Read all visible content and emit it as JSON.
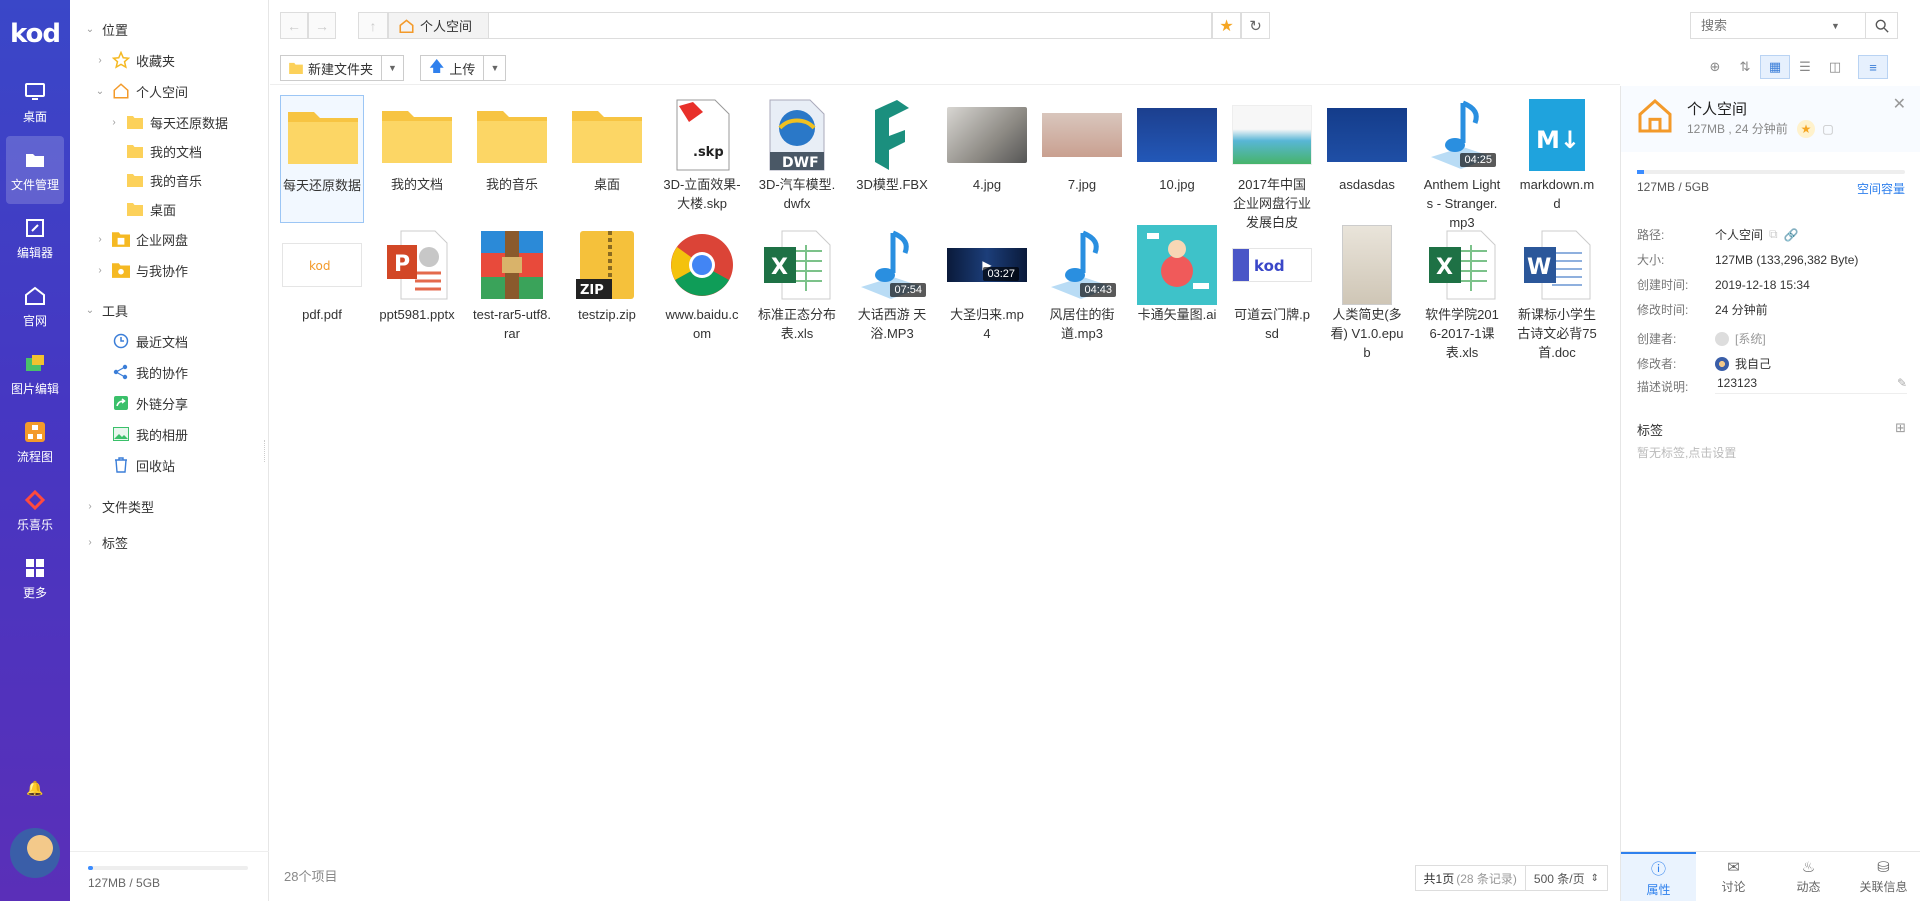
{
  "app": {
    "logo": "kod",
    "nav": [
      {
        "label": "桌面",
        "icon": "desktop-icon"
      },
      {
        "label": "文件管理",
        "icon": "folder-icon"
      },
      {
        "label": "编辑器",
        "icon": "editor-icon"
      },
      {
        "label": "官网",
        "icon": "home-icon"
      },
      {
        "label": "图片编辑",
        "icon": "image-edit-icon"
      },
      {
        "label": "流程图",
        "icon": "flowchart-icon"
      },
      {
        "label": "乐喜乐",
        "icon": "music-icon"
      },
      {
        "label": "更多",
        "icon": "grid-icon"
      }
    ]
  },
  "tree": {
    "location_title": "位置",
    "favorites": "收藏夹",
    "personal": "个人空间",
    "children": [
      "每天还原数据",
      "我的文档",
      "我的音乐",
      "桌面"
    ],
    "enterprise": "企业网盘",
    "collab": "与我协作",
    "tools_title": "工具",
    "tools": [
      "最近文档",
      "我的协作",
      "外链分享",
      "我的相册",
      "回收站"
    ],
    "file_types": "文件类型",
    "tags": "标签",
    "quota": "127MB / 5GB"
  },
  "topbar": {
    "path": "个人空间",
    "search_placeholder": "搜索"
  },
  "toolbar": {
    "new_folder": "新建文件夹",
    "upload": "上传"
  },
  "files_row1": [
    {
      "name": "每天还原数据",
      "kind": "folder",
      "selected": true
    },
    {
      "name": "我的文档",
      "kind": "folder"
    },
    {
      "name": "我的音乐",
      "kind": "folder"
    },
    {
      "name": "桌面",
      "kind": "folder"
    },
    {
      "name": "3D-立面效果-大楼.skp",
      "kind": "skp",
      "tag": ".skp"
    },
    {
      "name": "3D-汽车模型.dwfx",
      "kind": "dwf",
      "tag": "DWF"
    },
    {
      "name": "3D模型.FBX",
      "kind": "fbx"
    },
    {
      "name": "4.jpg",
      "kind": "photo-cat"
    },
    {
      "name": "7.jpg",
      "kind": "photo-sand"
    },
    {
      "name": "10.jpg",
      "kind": "photo-blue"
    },
    {
      "name": "2017年中国企业网盘行业发展白皮",
      "kind": "photo-doc"
    },
    {
      "name": "asdasdas",
      "kind": "photo-blue2"
    },
    {
      "name": "Anthem Lights - Stranger.mp3",
      "kind": "music",
      "duration": "04:25"
    },
    {
      "name": "markdown.md",
      "kind": "markdown",
      "tag": "M↓"
    }
  ],
  "files_row2": [
    {
      "name": "pdf.pdf",
      "kind": "pdf-thumb",
      "tag": "kod"
    },
    {
      "name": "ppt5981.pptx",
      "kind": "ppt",
      "tag": "P"
    },
    {
      "name": "test-rar5-utf8.rar",
      "kind": "rar"
    },
    {
      "name": "testzip.zip",
      "kind": "zip",
      "tag": "ZIP"
    },
    {
      "name": "www.baidu.com",
      "kind": "chrome"
    },
    {
      "name": "标准正态分布表.xls",
      "kind": "excel",
      "tag": "X"
    },
    {
      "name": "大话西游 天浴.MP3",
      "kind": "music",
      "duration": "07:54"
    },
    {
      "name": "大圣归来.mp4",
      "kind": "video",
      "duration": "03:27"
    },
    {
      "name": "风居住的街道.mp3",
      "kind": "music",
      "duration": "04:43"
    },
    {
      "name": "卡通矢量图.ai",
      "kind": "cartoon"
    },
    {
      "name": "可道云门牌.psd",
      "kind": "kodcloud",
      "tag": "kod"
    },
    {
      "name": "人类简史(多看) V1.0.epub",
      "kind": "book"
    },
    {
      "name": "软件学院2016-2017-1课表.xls",
      "kind": "excel",
      "tag": "X"
    },
    {
      "name": "新课标小学生古诗文必背75首.doc",
      "kind": "word",
      "tag": "W"
    }
  ],
  "footer": {
    "count": "28个项目",
    "page": "共1页",
    "records": "(28 条记录)",
    "per_page": "500 条/页"
  },
  "panel": {
    "title": "个人空间",
    "subtitle": "127MB , 24 分钟前",
    "quota_left": "127MB / 5GB",
    "quota_right": "空间容量",
    "rows": [
      {
        "k": "路径:",
        "v": "个人空间"
      },
      {
        "k": "大小:",
        "v": "127MB (133,296,382 Byte)"
      },
      {
        "k": "创建时间:",
        "v": "2019-12-18 15:34"
      },
      {
        "k": "修改时间:",
        "v": "24 分钟前"
      },
      {
        "k": "创建者:",
        "v": "[系统]"
      },
      {
        "k": "修改者:",
        "v": "我自己"
      }
    ],
    "desc_label": "描述说明:",
    "desc_value": "123123",
    "tags_title": "标签",
    "tags_empty": "暂无标签,点击设置",
    "tabs": [
      "属性",
      "讨论",
      "动态",
      "关联信息"
    ]
  },
  "colors": {
    "accent": "#2f80ed",
    "folder": "#fcd15a",
    "sidebar_top": "#3a47c8",
    "sidebar_bottom": "#5a2fb8"
  }
}
